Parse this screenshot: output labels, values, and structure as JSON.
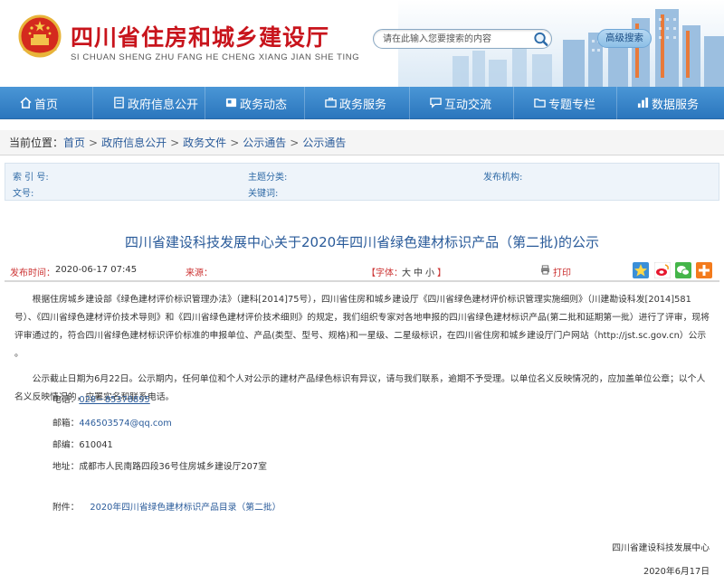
{
  "header": {
    "title": "四川省住房和城乡建设厅",
    "subtitle": "SI CHUAN SHENG ZHU FANG HE CHENG XIANG JIAN SHE TING",
    "search_placeholder": "请在此输入您要搜索的内容",
    "advanced_search": "高级搜索",
    "title_color": "#c8141c"
  },
  "nav": {
    "items": [
      {
        "label": "首页",
        "icon": "home-icon"
      },
      {
        "label": "政府信息公开",
        "icon": "document-icon"
      },
      {
        "label": "政务动态",
        "icon": "news-icon"
      },
      {
        "label": "政务服务",
        "icon": "service-icon"
      },
      {
        "label": "互动交流",
        "icon": "chat-icon"
      },
      {
        "label": "专题专栏",
        "icon": "folder-icon"
      },
      {
        "label": "数据服务",
        "icon": "chart-icon"
      }
    ],
    "color": "#3584ca"
  },
  "breadcrumb": {
    "label": "当前位置：",
    "items": [
      "首页",
      "政府信息公开",
      "政务文件",
      "公示通告",
      "公示通告"
    ]
  },
  "meta": {
    "index_label": "索 引 号:",
    "category_label": "主题分类:",
    "publisher_label": "发布机构:",
    "docno_label": "文号:",
    "keywords_label": "关键词:"
  },
  "article": {
    "title": "四川省建设科技发展中心关于2020年四川省绿色建材标识产品（第二批)的公示",
    "publish_label": "发布时间：",
    "publish_date": "2020-06-17 07:45",
    "source_label": "来源：",
    "font_label": "【字体：",
    "font_sizes": [
      "大",
      "中",
      "小"
    ],
    "font_close": "】",
    "print_label": "打印",
    "para1": "根据住房城乡建设部《绿色建材评价标识管理办法》（建科[2014]75号），四川省住房和城乡建设厅《四川省绿色建材评价标识管理实施细则》（川建勘设科发[2014]581号）、《四川省绿色建材评价技术导则》和《四川省绿色建材评价技术细则》的规定，我们组织专家对各地申报的四川省绿色建材标识产品(第二批和延期第一批）进行了评审，现将评审通过的，符合四川省绿色建材标识评价标准的申报单位、产品(类型、型号、规格)和一星级、二星级标识，在四川省住房和城乡建设厅门户网站（http://jst.sc.gov.cn）公示 。",
    "para2": "公示截止日期为6月22日。公示期内，任何单位和个人对公示的建材产品绿色标识有异议，请与我们联系，逾期不予受理。以单位名义反映情况的，应加盖单位公章；以个人名义反映情况的，应署实名和联系电话。",
    "phone_label": "电话：",
    "phone": "028－85378895",
    "email_label": "邮箱：",
    "email": "446503574@qq.com",
    "zip_label": "邮编：",
    "zip": "610041",
    "address_label": "地址：",
    "address": "成都市人民南路四段36号住房城乡建设厅207室",
    "attach_label": "附件：",
    "attach_link": "2020年四川省绿色建材标识产品目录（第二批）",
    "signature": "四川省建设科技发展中心",
    "sign_date": "2020年6月17日"
  }
}
